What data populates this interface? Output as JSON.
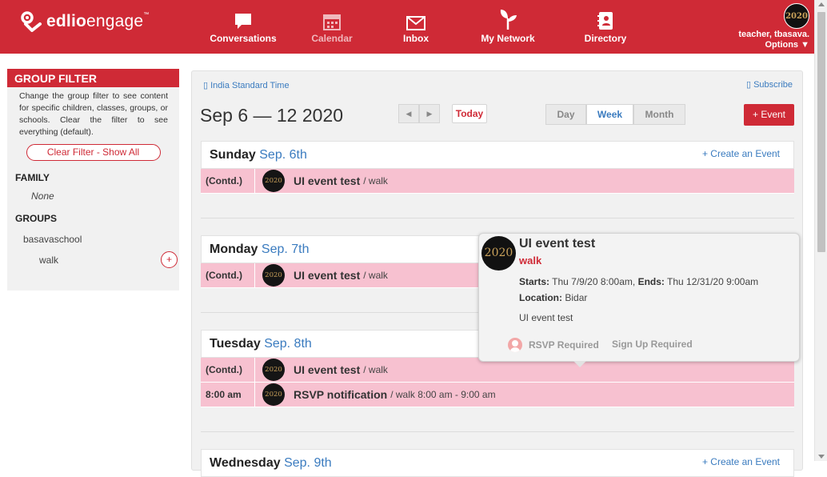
{
  "brand": {
    "logo_bold": "edlio",
    "logo_light": "engage",
    "tm": "™"
  },
  "nav": [
    {
      "label": "Conversations",
      "icon": "chat-bubble-icon"
    },
    {
      "label": "Calendar",
      "icon": "calendar-icon"
    },
    {
      "label": "Inbox",
      "icon": "envelope-icon"
    },
    {
      "label": "My Network",
      "icon": "sprout-icon"
    },
    {
      "label": "Directory",
      "icon": "contact-book-icon"
    }
  ],
  "user": {
    "name": "teacher, tbasava.",
    "options": "Options ▼",
    "avatar_text": "2020"
  },
  "sidebar": {
    "title": "GROUP FILTER",
    "description": "Change the group filter to see content for specific children, classes, groups, or schools. Clear the filter to see everything (default).",
    "clear_label": "Clear Filter - Show All",
    "family_heading": "FAMILY",
    "family_value": "None",
    "groups_heading": "GROUPS",
    "school": "basavaschool",
    "group": "walk",
    "add_label": "+"
  },
  "calendar": {
    "timezone": "India Standard Time",
    "subscribe": "Subscribe",
    "range": "Sep 6 — 12 2020",
    "prev": "◀",
    "next": "▶",
    "today": "Today",
    "views": [
      "Day",
      "Week",
      "Month"
    ],
    "active_view": "Week",
    "add_event": "+ Event",
    "create_event": "+ Create an Event",
    "days": [
      {
        "weekday": "Sunday",
        "date": "Sep. 6th",
        "events": [
          {
            "time": "(Contd.)",
            "title": "UI event test",
            "where": "/ walk"
          }
        ]
      },
      {
        "weekday": "Monday",
        "date": "Sep. 7th",
        "events": [
          {
            "time": "(Contd.)",
            "title": "UI event test",
            "where": "/ walk"
          }
        ]
      },
      {
        "weekday": "Tuesday",
        "date": "Sep. 8th",
        "events": [
          {
            "time": "(Contd.)",
            "title": "UI event test",
            "where": "/ walk"
          },
          {
            "time": "8:00 am",
            "title": "RSVP notification",
            "where": "/ walk 8:00 am - 9:00 am"
          }
        ]
      },
      {
        "weekday": "Wednesday",
        "date": "Sep. 9th",
        "events": []
      }
    ]
  },
  "popup": {
    "title": "UI event test",
    "group": "walk",
    "starts_label": "Starts:",
    "starts": "Thu 7/9/20 8:00am,",
    "ends_label": "Ends:",
    "ends": "Thu 12/31/20 9:00am",
    "location_label": "Location:",
    "location": "Bidar",
    "description": "UI event test",
    "rsvp": "RSVP Required",
    "signup": "Sign Up Required",
    "avatar_text": "2020"
  },
  "thumb_text": "2020",
  "colors": {
    "brand_red": "#cf2a36",
    "event_pink": "#f7c1d0",
    "link_blue": "#3a7bbf"
  }
}
